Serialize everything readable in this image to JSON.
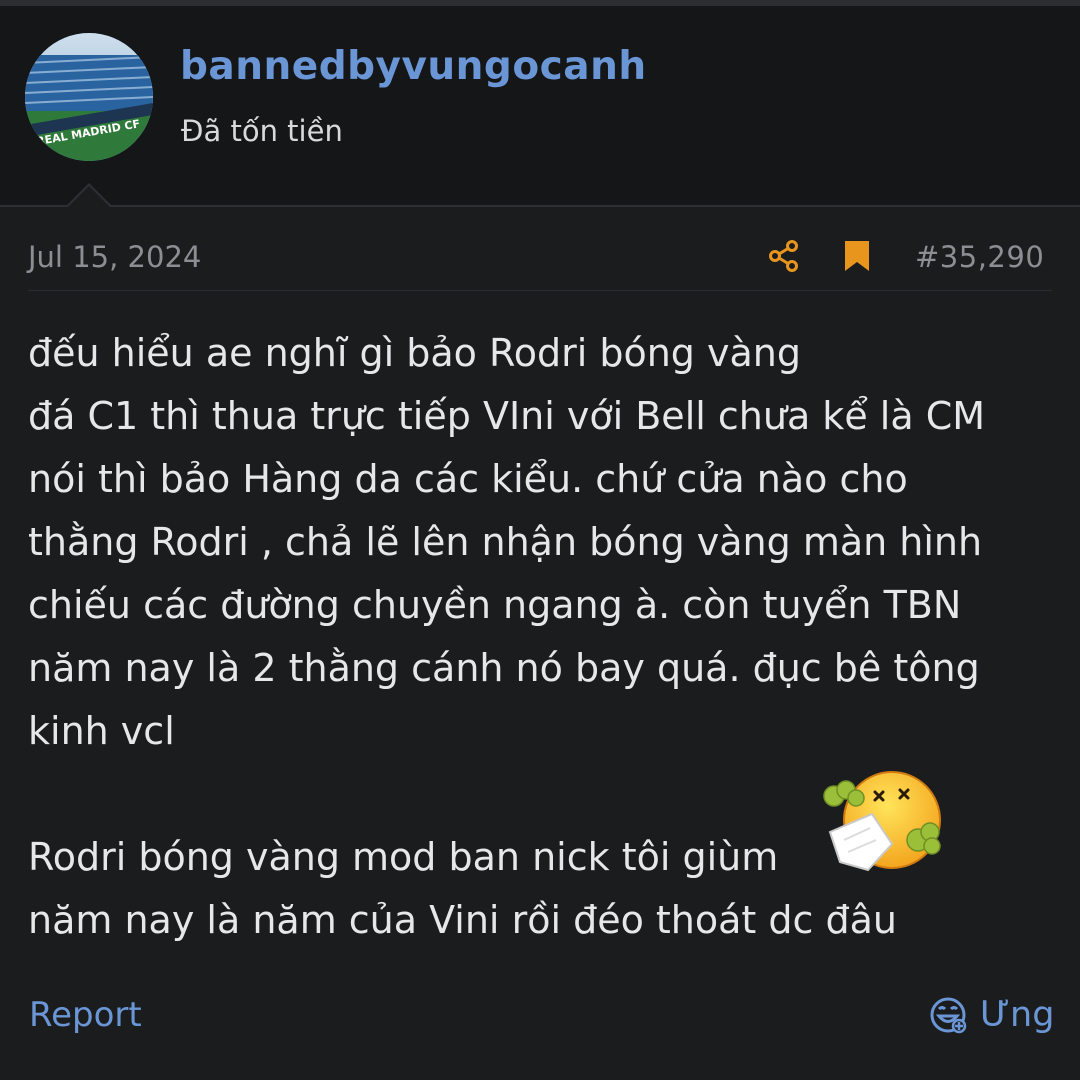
{
  "user": {
    "username": "bannedbyvungocanh",
    "title": "Đã tốn tiền",
    "avatar_text": "REAL MADRID CF"
  },
  "post": {
    "date": "Jul 15, 2024",
    "number": "#35,290",
    "lines": [
      "đếu hiểu ae nghĩ gì bảo Rodri bóng vàng",
      "đá C1 thì thua trực tiếp VIni với Bell chưa kể là CM",
      "nói thì bảo Hàng da các kiểu. chứ cửa nào cho",
      "thằng Rodri , chả lẽ lên nhận bóng vàng màn hình",
      "chiếu các đường chuyền ngang à. còn tuyển TBN",
      "năm nay là 2 thằng cánh nó bay quá. đục bê tông",
      "kinh vcl",
      "",
      "Rodri bóng vàng mod ban nick tôi giùm",
      "năm nay là năm của Vini rồi đéo thoát dc đâu"
    ]
  },
  "actions": {
    "report_label": "Report",
    "react_label": "Ưng"
  },
  "icons": {
    "share": "share-icon",
    "bookmark": "bookmark-icon",
    "react": "laugh-react-icon",
    "emoji": "sick-face-emoji"
  },
  "colors": {
    "background": "#1b1c1e",
    "header_bg": "#151618",
    "username": "#6b96d6",
    "link": "#6b96d6",
    "accent_orange": "#e8951e",
    "meta_text": "#8b8e93",
    "body_text": "#e6e7e9"
  }
}
